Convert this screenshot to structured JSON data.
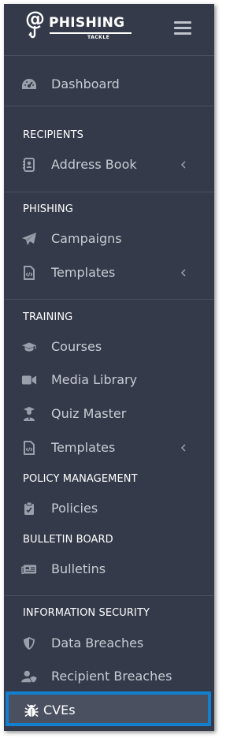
{
  "brand": {
    "logo_symbol": "@",
    "logo_word": "PHISHING",
    "logo_sub": "TACKLE",
    "menu_icon": "hamburger-icon"
  },
  "nav": {
    "dashboard": {
      "label": "Dashboard",
      "icon": "dashboard-icon"
    },
    "recipients": {
      "title": "RECIPIENTS",
      "address_book": {
        "label": "Address Book",
        "icon": "address-book-icon",
        "expandable": true
      }
    },
    "phishing": {
      "title": "PHISHING",
      "campaigns": {
        "label": "Campaigns",
        "icon": "paper-plane-icon"
      },
      "templates": {
        "label": "Templates",
        "icon": "code-file-icon",
        "expandable": true
      }
    },
    "training": {
      "title": "TRAINING",
      "courses": {
        "label": "Courses",
        "icon": "graduation-cap-icon"
      },
      "media_library": {
        "label": "Media Library",
        "icon": "video-camera-icon"
      },
      "quiz_master": {
        "label": "Quiz Master",
        "icon": "user-graduate-icon"
      },
      "templates": {
        "label": "Templates",
        "icon": "code-file-icon",
        "expandable": true
      }
    },
    "policy": {
      "title": "POLICY MANAGEMENT",
      "policies": {
        "label": "Policies",
        "icon": "clipboard-check-icon"
      }
    },
    "bulletin": {
      "title": "BULLETIN BOARD",
      "bulletins": {
        "label": "Bulletins",
        "icon": "newspaper-icon"
      }
    },
    "infosec": {
      "title": "INFORMATION SECURITY",
      "data_breaches": {
        "label": "Data Breaches",
        "icon": "shield-icon"
      },
      "recipient_breaches": {
        "label": "Recipient Breaches",
        "icon": "user-shield-icon"
      },
      "cves": {
        "label": "CVEs",
        "icon": "bug-icon",
        "active": true
      }
    }
  },
  "colors": {
    "sidebar_bg": "#343a4a",
    "active_border": "#1380cf",
    "text_muted": "#c9ccd3",
    "icon_muted": "#9aa0ab"
  }
}
